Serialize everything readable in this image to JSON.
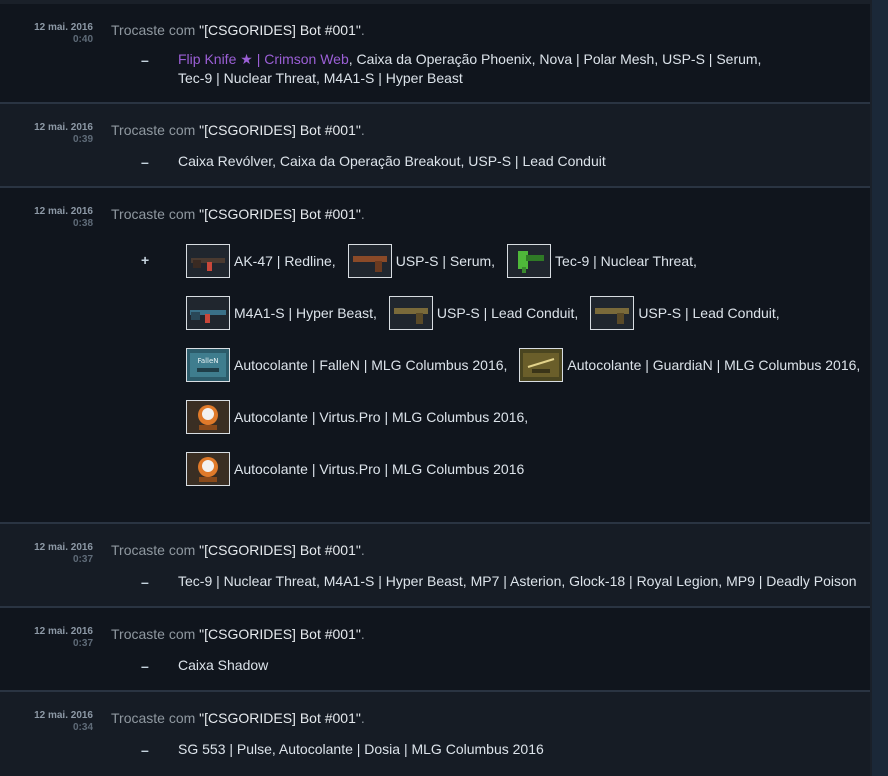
{
  "trades": [
    {
      "date": "12 mai. 2016",
      "time": "0:40",
      "prefix": "Trocaste com ",
      "partner": "\"[CSGORIDES] Bot #001\"",
      "suffix": ".",
      "sign": "–",
      "items_highlight": "Flip Knife ★ | Crimson Web",
      "items_line1": ", Caixa da Operação Phoenix, Nova | Polar Mesh, USP-S | Serum,",
      "items_line2": "Tec-9 | Nuclear Threat, M4A1-S | Hyper Beast"
    },
    {
      "date": "12 mai. 2016",
      "time": "0:39",
      "prefix": "Trocaste com ",
      "partner": "\"[CSGORIDES] Bot #001\"",
      "suffix": ".",
      "sign": "–",
      "items": "Caixa Revólver, Caixa da Operação Breakout, USP-S | Lead Conduit"
    },
    {
      "date": "12 mai. 2016",
      "time": "0:38",
      "prefix": "Trocaste com ",
      "partner": "\"[CSGORIDES] Bot #001\"",
      "suffix": ".",
      "sign": "+",
      "received": [
        {
          "name": "AK-47 | Redline,",
          "icon": "rifle-icon",
          "color": "#c8473a"
        },
        {
          "name": "USP-S | Serum,",
          "icon": "pistol-icon",
          "color": "#b8632f"
        },
        {
          "name": "Tec-9 | Nuclear Threat,",
          "icon": "smg-icon",
          "color": "#4fb83a"
        },
        {
          "name": "M4A1-S | Hyper Beast,",
          "icon": "rifle-icon",
          "color": "#3aa0c8"
        },
        {
          "name": "USP-S | Lead Conduit,",
          "icon": "pistol-icon",
          "color": "#c9a33a"
        },
        {
          "name": "USP-S | Lead Conduit,",
          "icon": "pistol-icon",
          "color": "#c9a33a"
        },
        {
          "name": "Autocolante | FalleN | MLG Columbus 2016,",
          "icon": "sticker-icon",
          "label": "FalleN"
        },
        {
          "name": "Autocolante | GuardiaN | MLG Columbus 2016,",
          "icon": "sticker-icon",
          "label": ""
        },
        {
          "name": "Autocolante | Virtus.Pro | MLG Columbus 2016,",
          "icon": "sticker-icon",
          "label": ""
        },
        {
          "name": "Autocolante | Virtus.Pro | MLG Columbus 2016",
          "icon": "sticker-icon",
          "label": ""
        }
      ]
    },
    {
      "date": "12 mai. 2016",
      "time": "0:37",
      "prefix": "Trocaste com ",
      "partner": "\"[CSGORIDES] Bot #001\"",
      "suffix": ".",
      "sign": "–",
      "items": "Tec-9 | Nuclear Threat, M4A1-S | Hyper Beast, MP7 | Asterion, Glock-18 | Royal Legion, MP9 | Deadly Poison"
    },
    {
      "date": "12 mai. 2016",
      "time": "0:37",
      "prefix": "Trocaste com ",
      "partner": "\"[CSGORIDES] Bot #001\"",
      "suffix": ".",
      "sign": "–",
      "items": "Caixa Shadow"
    },
    {
      "date": "12 mai. 2016",
      "time": "0:34",
      "prefix": "Trocaste com ",
      "partner": "\"[CSGORIDES] Bot #001\"",
      "suffix": ".",
      "sign": "–",
      "items": "SG 553 | Pulse, Autocolante | Dosia | MLG Columbus 2016"
    }
  ]
}
